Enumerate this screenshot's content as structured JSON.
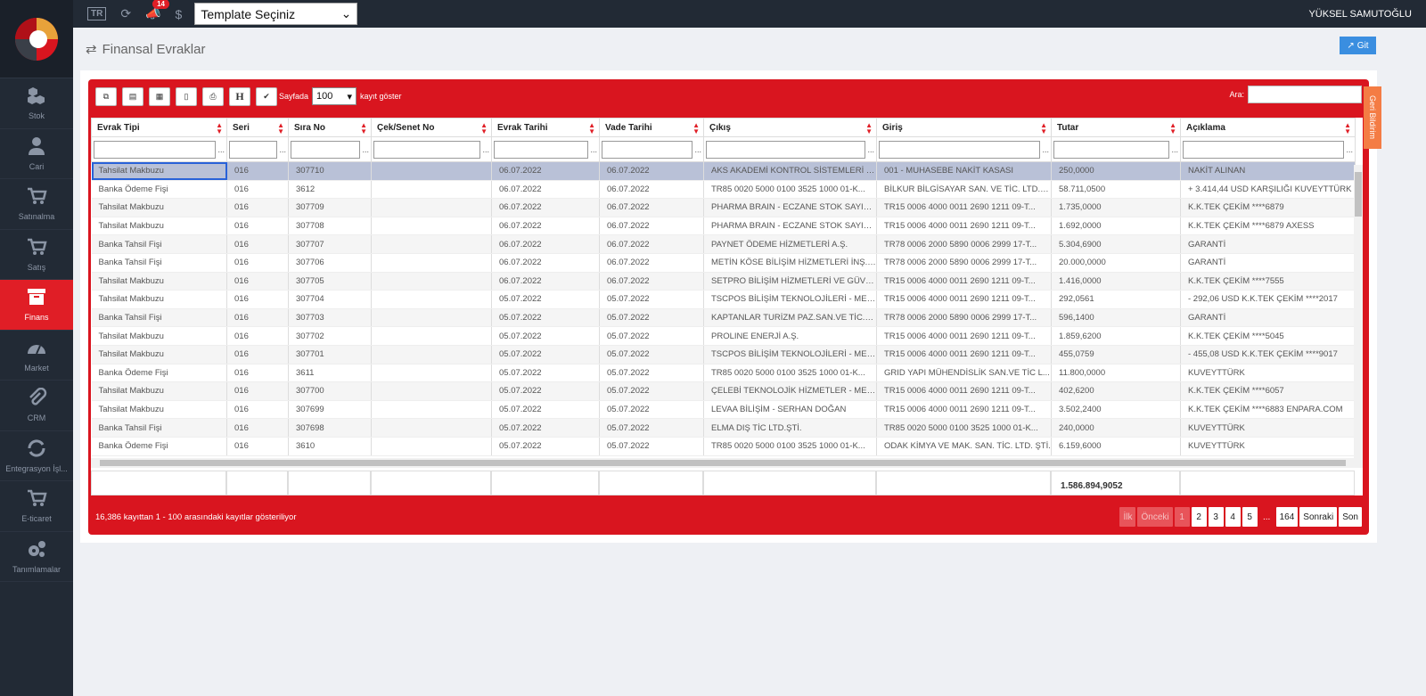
{
  "topbar": {
    "lang": "TR",
    "notif_count": "14",
    "template_select": "Template Seçiniz",
    "user": "YÜKSEL SAMUTOĞLU"
  },
  "sidebar": {
    "items": [
      {
        "label": "Stok",
        "icon": "cubes-icon"
      },
      {
        "label": "Cari",
        "icon": "user-icon"
      },
      {
        "label": "Satınalma",
        "icon": "cart-icon"
      },
      {
        "label": "Satış",
        "icon": "cart-icon"
      },
      {
        "label": "Finans",
        "icon": "archive-icon",
        "active": true
      },
      {
        "label": "Market",
        "icon": "dashboard-icon"
      },
      {
        "label": "CRM",
        "icon": "paperclip-icon"
      },
      {
        "label": "Entegrasyon İşl...",
        "icon": "refresh-icon"
      },
      {
        "label": "E-ticaret",
        "icon": "cart-icon"
      },
      {
        "label": "Tanımlamalar",
        "icon": "gears-icon"
      }
    ]
  },
  "page": {
    "title": "Finansal Evraklar",
    "go_button": "Git",
    "side_tab": "Geri Bildirim"
  },
  "toolbar": {
    "page_size_prefix": "Sayfada",
    "page_size": "100",
    "page_size_suffix": "kayıt göster",
    "search_label": "Ara:",
    "h_label": "H"
  },
  "table": {
    "columns": [
      "Evrak Tipi",
      "Seri",
      "Sıra No",
      "Çek/Senet No",
      "Evrak Tarihi",
      "Vade Tarihi",
      "Çıkış",
      "Giriş",
      "Tutar",
      "Açıklama"
    ],
    "rows": [
      [
        "Tahsilat Makbuzu",
        "016",
        "307710",
        "",
        "06.07.2022",
        "06.07.2022",
        "AKS AKADEMİ KONTROL SİSTEMLERİ Y...",
        "001 - MUHASEBE NAKİT KASASI",
        "250,0000",
        "NAKİT ALINAN"
      ],
      [
        "Banka Ödeme Fişi",
        "016",
        "3612",
        "",
        "06.07.2022",
        "06.07.2022",
        "TR85 0020 5000 0100 3525 1000 01-K...",
        "BİLKUR BİLGİSAYAR SAN. VE TİC. LTD. Ş...",
        "58.711,0500",
        "+ 3.414,44 USD KARŞILIĞI KUVEYTTÜRK"
      ],
      [
        "Tahsilat Makbuzu",
        "016",
        "307709",
        "",
        "06.07.2022",
        "06.07.2022",
        "PHARMA BRAIN - ECZANE STOK SAYIM...",
        "TR15 0006 4000 0011 2690 1211 09-T...",
        "1.735,0000",
        "K.K.TEK ÇEKİM ****6879"
      ],
      [
        "Tahsilat Makbuzu",
        "016",
        "307708",
        "",
        "06.07.2022",
        "06.07.2022",
        "PHARMA BRAIN - ECZANE STOK SAYIM...",
        "TR15 0006 4000 0011 2690 1211 09-T...",
        "1.692,0000",
        "K.K.TEK ÇEKİM ****6879 AXESS"
      ],
      [
        "Banka Tahsil Fişi",
        "016",
        "307707",
        "",
        "06.07.2022",
        "06.07.2022",
        "PAYNET ÖDEME HİZMETLERİ A.Ş.",
        "TR78 0006 2000 5890 0006 2999 17-T...",
        "5.304,6900",
        "GARANTİ"
      ],
      [
        "Banka Tahsil Fişi",
        "016",
        "307706",
        "",
        "06.07.2022",
        "06.07.2022",
        "METİN KÖSE BİLİŞİM HİZMETLERİ İNŞ.T...",
        "TR78 0006 2000 5890 0006 2999 17-T...",
        "20.000,0000",
        "GARANTİ"
      ],
      [
        "Tahsilat Makbuzu",
        "016",
        "307705",
        "",
        "06.07.2022",
        "06.07.2022",
        "SETPRO BİLİŞİM HİZMETLERİ VE GÜVE...",
        "TR15 0006 4000 0011 2690 1211 09-T...",
        "1.416,0000",
        "K.K.TEK ÇEKİM ****7555"
      ],
      [
        "Tahsilat Makbuzu",
        "016",
        "307704",
        "",
        "05.07.2022",
        "05.07.2022",
        "TSCPOS BİLİŞİM TEKNOLOJİLERİ - MEH...",
        "TR15 0006 4000 0011 2690 1211 09-T...",
        "292,0561",
        "- 292,06 USD K.K.TEK ÇEKİM ****2017"
      ],
      [
        "Banka Tahsil Fişi",
        "016",
        "307703",
        "",
        "05.07.2022",
        "05.07.2022",
        "KAPTANLAR TURİZM PAZ.SAN.VE TİC.A.Ş.",
        "TR78 0006 2000 5890 0006 2999 17-T...",
        "596,1400",
        "GARANTİ"
      ],
      [
        "Tahsilat Makbuzu",
        "016",
        "307702",
        "",
        "05.07.2022",
        "05.07.2022",
        "PROLINE ENERJİ A.Ş.",
        "TR15 0006 4000 0011 2690 1211 09-T...",
        "1.859,6200",
        "K.K.TEK ÇEKİM ****5045"
      ],
      [
        "Tahsilat Makbuzu",
        "016",
        "307701",
        "",
        "05.07.2022",
        "05.07.2022",
        "TSCPOS BİLİŞİM TEKNOLOJİLERİ - MEH...",
        "TR15 0006 4000 0011 2690 1211 09-T...",
        "455,0759",
        "- 455,08 USD K.K.TEK ÇEKİM ****9017"
      ],
      [
        "Banka Ödeme Fişi",
        "016",
        "3611",
        "",
        "05.07.2022",
        "05.07.2022",
        "TR85 0020 5000 0100 3525 1000 01-K...",
        "GRID YAPI MÜHENDİSLİK SAN.VE TİC L...",
        "11.800,0000",
        "KUVEYTTÜRK"
      ],
      [
        "Tahsilat Makbuzu",
        "016",
        "307700",
        "",
        "05.07.2022",
        "05.07.2022",
        "ÇELEBİ TEKNOLOJİK HİZMETLER - MEH...",
        "TR15 0006 4000 0011 2690 1211 09-T...",
        "402,6200",
        "K.K.TEK ÇEKİM ****6057"
      ],
      [
        "Tahsilat Makbuzu",
        "016",
        "307699",
        "",
        "05.07.2022",
        "05.07.2022",
        "LEVAA BİLİŞİM - SERHAN DOĞAN",
        "TR15 0006 4000 0011 2690 1211 09-T...",
        "3.502,2400",
        "K.K.TEK ÇEKİM ****6883 ENPARA.COM"
      ],
      [
        "Banka Tahsil Fişi",
        "016",
        "307698",
        "",
        "05.07.2022",
        "05.07.2022",
        "ELMA DIŞ TİC LTD.ŞTİ.",
        "TR85 0020 5000 0100 3525 1000 01-K...",
        "240,0000",
        "KUVEYTTÜRK"
      ],
      [
        "Banka Ödeme Fişi",
        "016",
        "3610",
        "",
        "05.07.2022",
        "05.07.2022",
        "TR85 0020 5000 0100 3525 1000 01-K...",
        "ODAK KİMYA VE MAK. SAN. TİC. LTD. ŞTİ.",
        "6.159,6000",
        "KUVEYTTÜRK"
      ]
    ],
    "total": "1.586.894,9052",
    "selected_row": 0
  },
  "footer": {
    "status": "16,386 kayıttan 1 - 100 arasındaki kayıtlar gösteriliyor",
    "pager": [
      "İlk",
      "Önceki",
      "1",
      "2",
      "3",
      "4",
      "5",
      "...",
      "164",
      "Sonraki",
      "Son"
    ]
  },
  "colors": {
    "accent": "#d9151f",
    "sidebar": "#222a35",
    "active": "#e01e26"
  }
}
